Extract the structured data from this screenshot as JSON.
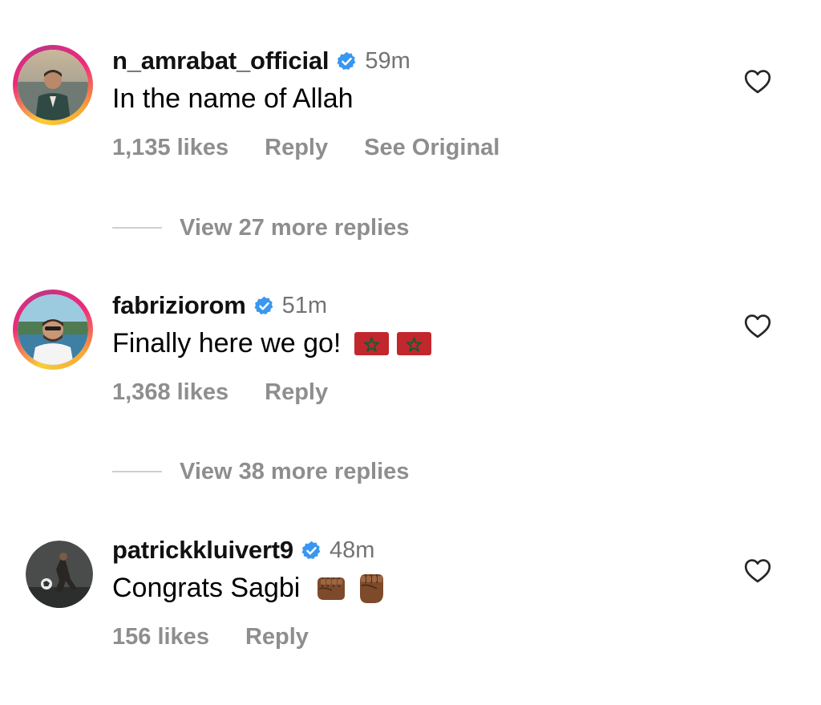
{
  "comments": [
    {
      "username": "n_amrabat_official",
      "verified": true,
      "time": "59m",
      "text": "In the name of Allah",
      "likes": "1,135 likes",
      "reply": "Reply",
      "see_original": "See Original",
      "emoji": [],
      "has_story_ring": true,
      "view_replies": "View 27 more replies"
    },
    {
      "username": "fabriziorom",
      "verified": true,
      "time": "51m",
      "text": "Finally here we go!",
      "likes": "1,368 likes",
      "reply": "Reply",
      "emoji": [
        "morocco-flag",
        "morocco-flag"
      ],
      "has_story_ring": true,
      "view_replies": "View 38 more replies"
    },
    {
      "username": "patrickkluivert9",
      "verified": true,
      "time": "48m",
      "text": "Congrats Sagbi",
      "likes": "156 likes",
      "reply": "Reply",
      "emoji": [
        "left-facing-fist",
        "raised-fist"
      ],
      "has_story_ring": false
    }
  ],
  "colors": {
    "verified": "#3897f0",
    "secondary_text": "#8e8e8e",
    "timestamp": "#737373",
    "primary_text": "#000000"
  }
}
